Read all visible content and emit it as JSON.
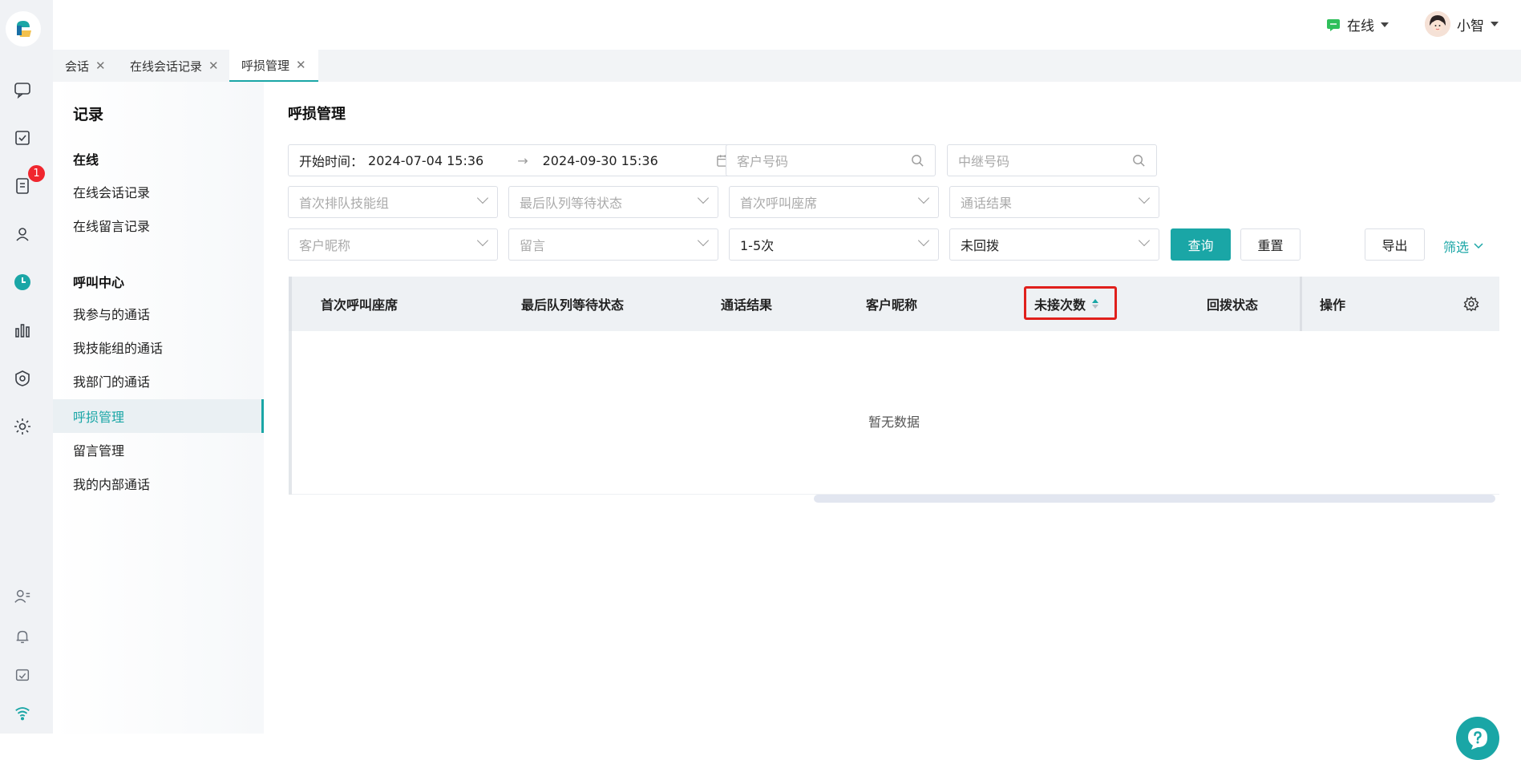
{
  "topbar": {
    "status_label": "在线",
    "user_name": "小智"
  },
  "rail": {
    "badge_count": "1",
    "accent_color": "#1aa6a6"
  },
  "tabs": [
    {
      "label": "会话"
    },
    {
      "label": "在线会话记录"
    },
    {
      "label": "呼损管理"
    }
  ],
  "subnav": {
    "title": "记录",
    "group_online": "在线",
    "online_items": [
      "在线会话记录",
      "在线留言记录"
    ],
    "group_call": "呼叫中心",
    "call_items": [
      "我参与的通话",
      "我技能组的通话",
      "我部门的通话",
      "呼损管理",
      "留言管理",
      "我的内部通话"
    ]
  },
  "page": {
    "title": "呼损管理",
    "date_range": {
      "label": "开始时间：",
      "start": "2024-07-04 15:36",
      "end": "2024-09-30 15:36"
    },
    "customer_number_placeholder": "客户号码",
    "trunk_number_placeholder": "中继号码",
    "first_skill_group_placeholder": "首次排队技能组",
    "last_queue_status_placeholder": "最后队列等待状态",
    "first_agent_placeholder": "首次呼叫座席",
    "call_result_placeholder": "通话结果",
    "customer_nickname_placeholder": "客户昵称",
    "message_placeholder": "留言",
    "missed_count_value": "1-5次",
    "callback_status_value": "未回拨",
    "query_label": "查询",
    "reset_label": "重置",
    "export_label": "导出",
    "filter_label": "筛选"
  },
  "table": {
    "columns": [
      "首次呼叫座席",
      "最后队列等待状态",
      "通话结果",
      "客户昵称",
      "未接次数",
      "回拨状态",
      "操作"
    ],
    "empty_text": "暂无数据"
  }
}
